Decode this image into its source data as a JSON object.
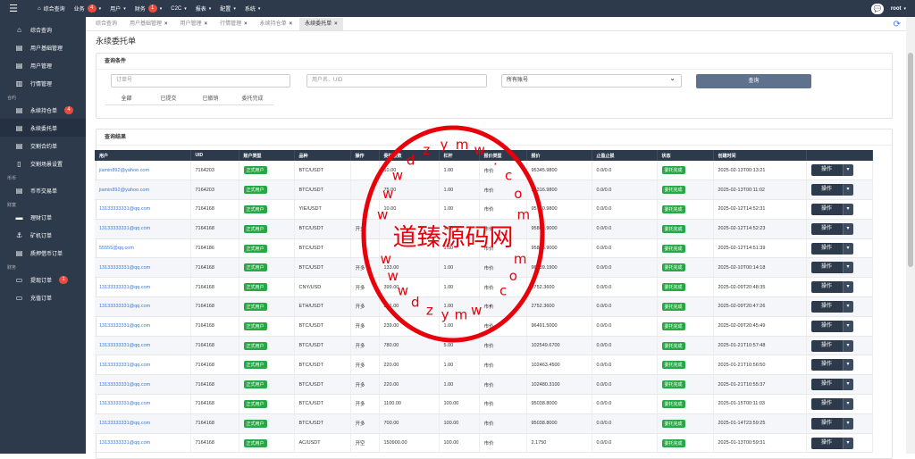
{
  "topbar": {
    "nav": [
      {
        "icon": "home-icon",
        "label": "综合查询",
        "badge": "",
        "caret": false
      },
      {
        "label": "业务",
        "badge": "4",
        "caret": true
      },
      {
        "label": "用户",
        "badge": "",
        "caret": true
      },
      {
        "label": "财务",
        "badge": "1",
        "caret": true
      },
      {
        "label": "C2C",
        "badge": "",
        "caret": true
      },
      {
        "label": "报表",
        "badge": "",
        "caret": true
      },
      {
        "label": "配置",
        "badge": "",
        "caret": true
      },
      {
        "label": "系统",
        "badge": "",
        "caret": true
      }
    ],
    "user": "root"
  },
  "sidebar": {
    "items": [
      {
        "icon": "home-icon",
        "label": "综合查询",
        "badge": ""
      },
      {
        "icon": "document-icon",
        "label": "用户基础管理",
        "badge": ""
      },
      {
        "icon": "document-icon",
        "label": "用户管理",
        "badge": ""
      },
      {
        "icon": "chart-icon",
        "label": "行情管理",
        "badge": ""
      }
    ],
    "group_contract": "合约",
    "contract_items": [
      {
        "icon": "document-icon",
        "label": "永续持仓单",
        "badge": "4"
      },
      {
        "icon": "document-icon",
        "label": "永续委托单",
        "badge": "",
        "active": true
      },
      {
        "icon": "document-icon",
        "label": "交割合约单",
        "badge": ""
      },
      {
        "icon": "columns-icon",
        "label": "交割场景设置",
        "badge": ""
      }
    ],
    "group_coin": "币币",
    "coin_items": [
      {
        "icon": "document-icon",
        "label": "币币交易单",
        "badge": ""
      }
    ],
    "group_wealth": "财富",
    "wealth_items": [
      {
        "icon": "folder-icon",
        "label": "理财订单",
        "badge": ""
      },
      {
        "icon": "anchor-icon",
        "label": "矿机订单",
        "badge": ""
      },
      {
        "icon": "document-icon",
        "label": "质押借币订单",
        "badge": ""
      }
    ],
    "group_finance": "财务",
    "finance_items": [
      {
        "icon": "card-icon",
        "label": "提现订单",
        "badge": "1"
      },
      {
        "icon": "card-icon",
        "label": "充值订单",
        "badge": ""
      }
    ]
  },
  "tabs": [
    {
      "label": "综合查询",
      "closable": false,
      "active": false
    },
    {
      "label": "用户基础管理",
      "closable": true,
      "active": false
    },
    {
      "label": "用户管理",
      "closable": true,
      "active": false
    },
    {
      "label": "行情管理",
      "closable": true,
      "active": false
    },
    {
      "label": "永续持仓单",
      "closable": true,
      "active": false
    },
    {
      "label": "永续委托单",
      "closable": true,
      "active": true
    }
  ],
  "page_title": "永续委托单",
  "query": {
    "title": "查询条件",
    "order_no_placeholder": "订单号",
    "user_placeholder": "用户名、UID",
    "account_select": "所有账号",
    "search_button": "查询",
    "filter_tabs": [
      "全部",
      "已提交",
      "已撤销",
      "委托完成"
    ]
  },
  "results": {
    "title": "查询结果",
    "columns": [
      "用户",
      "UID",
      "账户类型",
      "品种",
      "操作",
      "委托张数",
      "杠杆",
      "报价类型",
      "报价",
      "止盈止损",
      "状态",
      "创建时间",
      ""
    ],
    "op_button": "操作",
    "rows": [
      [
        "jiamin892@yahoo.com",
        "7164203",
        "正式用户",
        "BTC/USDT",
        "",
        "10.00",
        "1.00",
        "市价",
        "95345.9800",
        "0.0/0.0",
        "委托完成",
        "2025-02-13T00:13:21"
      ],
      [
        "jiamin892@yahoo.com",
        "7164203",
        "正式用户",
        "BTC/USDT",
        "",
        "75.00",
        "1.00",
        "市价",
        "95316.9800",
        "0.0/0.0",
        "委托完成",
        "2025-02-13T00:11:02"
      ],
      [
        "13133333331@qq.com",
        "7164168",
        "正式用户",
        "YIE/USDT",
        "",
        "10.00",
        "1.00",
        "市价",
        "95750.9800",
        "0.0/0.0",
        "委托完成",
        "2025-02-12T14:52:31"
      ],
      [
        "13133333331@qq.com",
        "7164168",
        "正式用户",
        "BTC/USDT",
        "开多",
        "",
        "1.00",
        "市价",
        "95860.9000",
        "0.0/0.0",
        "委托完成",
        "2025-02-12T14:52:23"
      ],
      [
        "55555@qq.com",
        "7164186",
        "正式用户",
        "BTC/USDT",
        "",
        "",
        "1.00",
        "市价",
        "95865.9000",
        "0.0/0.0",
        "委托完成",
        "2025-02-12T14:51:39"
      ],
      [
        "13133333331@qq.com",
        "7164168",
        "正式用户",
        "BTC/USDT",
        "开多",
        "133.00",
        "1.00",
        "市价",
        "96489.1900",
        "0.0/0.0",
        "委托完成",
        "2025-02-10T00:14:18"
      ],
      [
        "13133333331@qq.com",
        "7164168",
        "正式用户",
        "CNY/USD",
        "开多",
        "399.00",
        "1.00",
        "市价",
        "2752.3600",
        "0.0/0.0",
        "委托完成",
        "2025-02-09T20:48:35"
      ],
      [
        "13133333331@qq.com",
        "7164168",
        "正式用户",
        "ETH/USDT",
        "开多",
        "291.00",
        "1.00",
        "市价",
        "2752.3600",
        "0.0/0.0",
        "委托完成",
        "2025-02-09T20:47:26"
      ],
      [
        "13133333331@qq.com",
        "7164168",
        "正式用户",
        "BTC/USDT",
        "开多",
        "239.00",
        "1.00",
        "市价",
        "96491.5000",
        "0.0/0.0",
        "委托完成",
        "2025-02-09T20:45:49"
      ],
      [
        "13133333331@qq.com",
        "7164168",
        "正式用户",
        "BTC/USDT",
        "开多",
        "780.00",
        "5.00",
        "市价",
        "102549.6700",
        "0.0/0.0",
        "委托完成",
        "2025-01-21T10:57:48"
      ],
      [
        "13133333331@qq.com",
        "7164168",
        "正式用户",
        "BTC/USDT",
        "开多",
        "220.00",
        "1.00",
        "市价",
        "102463.4500",
        "0.0/0.0",
        "委托完成",
        "2025-01-21T10:56:50"
      ],
      [
        "13133333331@qq.com",
        "7164168",
        "正式用户",
        "BTC/USDT",
        "开多",
        "220.00",
        "1.00",
        "市价",
        "102480.3100",
        "0.0/0.0",
        "委托完成",
        "2025-01-21T10:55:37"
      ],
      [
        "13133333331@qq.com",
        "7164168",
        "正式用户",
        "BTC/USDT",
        "开多",
        "1100.00",
        "100.00",
        "市价",
        "95038.8000",
        "0.0/0.0",
        "委托完成",
        "2025-01-15T00:11:03"
      ],
      [
        "13133333331@qq.com",
        "7164168",
        "正式用户",
        "BTC/USDT",
        "开多",
        "700.00",
        "100.00",
        "市价",
        "95038.8000",
        "0.0/0.0",
        "委托完成",
        "2025-01-14T23:59:25"
      ],
      [
        "13133333331@qq.com",
        "7164168",
        "正式用户",
        "AC/USDT",
        "开空",
        "150900.00",
        "100.00",
        "市价",
        "2.1750",
        "0.0/0.0",
        "委托完成",
        "2025-01-13T00:59:31"
      ]
    ]
  },
  "watermark": {
    "main_text": "道臻源码网",
    "arc_letters_top": [
      "w",
      "w",
      "w",
      "d",
      "z",
      "y",
      "m",
      "w",
      ".",
      "c",
      "o",
      "m"
    ],
    "arc_letters_bottom": [
      "w",
      "w",
      "w",
      "d",
      "z",
      "y",
      "m",
      "w",
      ".",
      "c",
      "o",
      "m"
    ],
    "color": "#e8000b"
  },
  "colors": {
    "dark": "#2d3a4b",
    "green": "#27a844",
    "link": "#3a7bd5",
    "badge": "#e74c3c"
  }
}
